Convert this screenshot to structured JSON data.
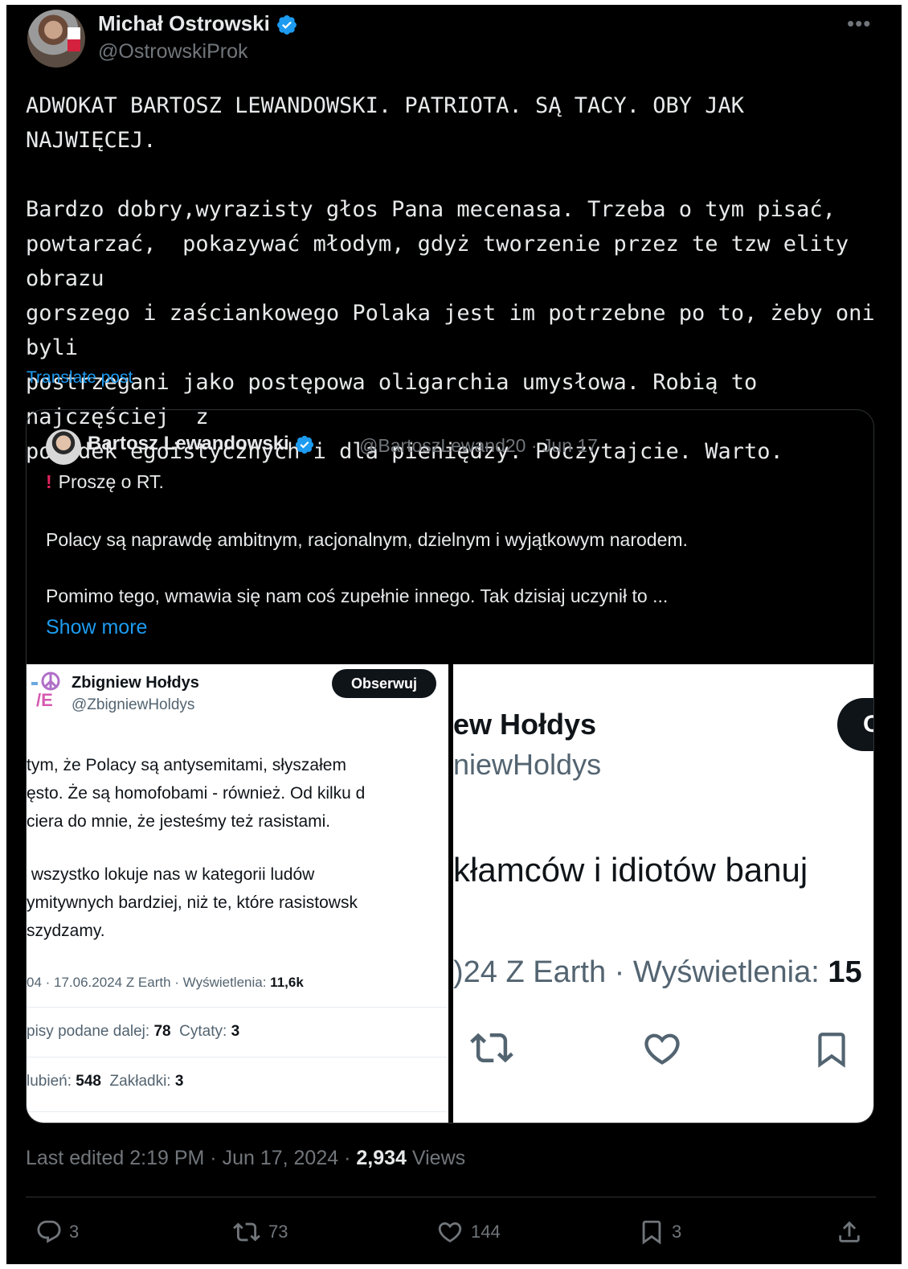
{
  "author": {
    "name": "Michał Ostrowski",
    "handle": "@OstrowskiProk"
  },
  "post": {
    "text": "ADWOKAT BARTOSZ LEWANDOWSKI. PATRIOTA. SĄ TACY. OBY JAK\nNAJWIĘCEJ.\n\nBardzo dobry,wyrazisty głos Pana mecenasa. Trzeba o tym pisać,\npowtarzać,  pokazywać młodym, gdyż tworzenie przez te tzw elity obrazu\ngorszego i zaściankowego Polaka jest im potrzebne po to, żeby oni byli\npostrzegani jako postępowa oligarchia umysłowa. Robią to najczęściej  z\npobudek egoistycznych i dla pieniędzy. Poczytajcie. Warto.",
    "translate_label": "Translate post"
  },
  "quote": {
    "name": "Bartosz Lewandowski",
    "handle_date": "@BartoszLewand20 · Jun 17",
    "line1": "Proszę o RT.",
    "line2": "Polacy są naprawdę ambitnym, racjonalnym, dzielnym i wyjątkowym narodem.",
    "line3": "Pomimo tego, wmawia się nam coś zupełnie innego. Tak dzisiaj uczynił to ...",
    "show_more": "Show more",
    "exclaim": "!"
  },
  "image_left": {
    "name": "Zbigniew Hołdys",
    "handle": "@ZbigniewHoldys",
    "follow": "Obserwuj",
    "para1": "tym, że Polacy są antysemitami, słyszałem\nęsto. Że są homofobami - również. Od kilku d\nciera do mnie, że jesteśmy też rasistami.",
    "para2": " wszystko lokuje nas w kategorii ludów\nymitywnych bardziej, niż te, które rasistowsk\nszydzamy.",
    "meta_prefix": "04 · 17.06.2024 Z Earth · Wyświetlenia: ",
    "meta_views": "11,6k",
    "stats1_label": "pisy podane dalej: ",
    "stats1_value": "78",
    "stats1_label2": "Cytaty: ",
    "stats1_value2": "3",
    "stats2_label": "lubień: ",
    "stats2_value": "548",
    "stats2_label2": "Zakładki: ",
    "stats2_value2": "3"
  },
  "image_right": {
    "name": "ew Hołdys",
    "handle": "niewHoldys",
    "follow": "O",
    "text": "kłamców i idiotów banuj",
    "meta_prefix": ")24 Z Earth · Wyświetlenia: ",
    "meta_views": "15"
  },
  "footer": {
    "edited": "Last edited 2:19 PM · Jun 17, 2024 · ",
    "views_count": "2,934",
    "views_label": " Views"
  },
  "actions": {
    "replies": "3",
    "reposts": "73",
    "likes": "144",
    "bookmarks": "3"
  },
  "colors": {
    "background": "#000000",
    "text": "#e7e9ea",
    "secondary": "#71767b",
    "accent": "#1d9bf0"
  }
}
